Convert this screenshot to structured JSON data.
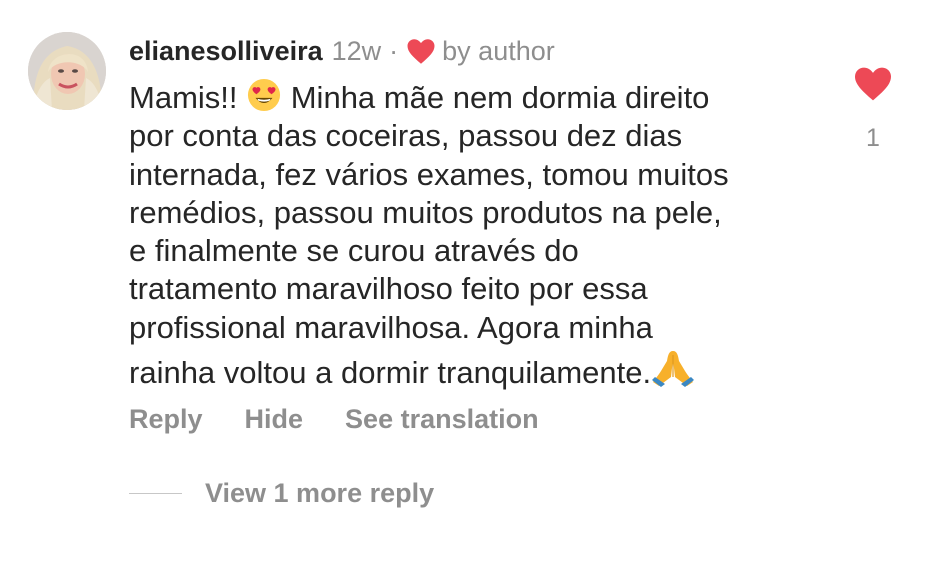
{
  "comment": {
    "username": "elianesolliveira",
    "age": "12w",
    "separator": "·",
    "liked_by_author_label": "by author",
    "text_part1": "Mamis!! ",
    "text_part2": " Minha mãe nem dormia direito\npor conta das coceiras, passou dez dias\ninternada, fez vários exames, tomou muitos\nremédios, passou muitos produtos na pele,\ne finalmente se curou através do\ntratamento maravilhoso feito por essa\nprofissional maravilhosa. Agora minha\nrainha voltou a dormir tranquilamente.",
    "emoji_1": "heart-eyes-emoji",
    "emoji_2": "folded-hands-emoji"
  },
  "actions": {
    "reply": "Reply",
    "hide": "Hide",
    "translate": "See translation"
  },
  "replies": {
    "view_more": "View 1 more reply"
  },
  "like": {
    "count": "1",
    "liked": true
  },
  "colors": {
    "heart": "#ed4956",
    "muted": "#8e8e8e",
    "text": "#262626"
  }
}
